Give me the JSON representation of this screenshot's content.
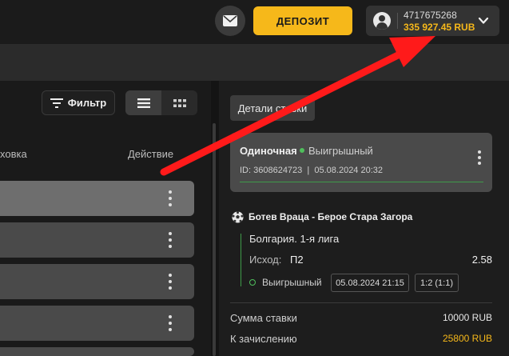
{
  "header": {
    "deposit_label": "ДЕПОЗИТ",
    "account_id": "4717675268",
    "balance": "335 927.45 RUB",
    "icons": {
      "mail": "mail-icon",
      "avatar": "user-avatar-icon",
      "chevron": "chevron-down-icon"
    }
  },
  "bets_list": {
    "filter_label": "Фильтр",
    "column_stake": "ховка",
    "column_action": "Действие",
    "rows": [
      {},
      {},
      {},
      {},
      {}
    ]
  },
  "details": {
    "tab_label": "Детали ставки",
    "bet_type": "Одиночная",
    "bet_status": "Выигрышный",
    "bet_id_line": "ID: 3608624723  |  05.08.2024 20:32",
    "match": "Ботев Враца - Берое Стара Загора",
    "league": "Болгария. 1-я лига",
    "outcome_label": "Исход:",
    "outcome_value": "П2",
    "odds": "2.58",
    "leg_status": "Выигрышный",
    "leg_date": "05.08.2024 21:15",
    "leg_score": "1:2 (1:1)",
    "stake_label": "Сумма ставки",
    "stake_value": "10000 RUB",
    "payout_label": "К зачислению",
    "payout_value": "25800 RUB"
  },
  "colors": {
    "accent": "#f6b81a",
    "win": "#4fbf5c",
    "arrow": "#ff1a1a"
  }
}
